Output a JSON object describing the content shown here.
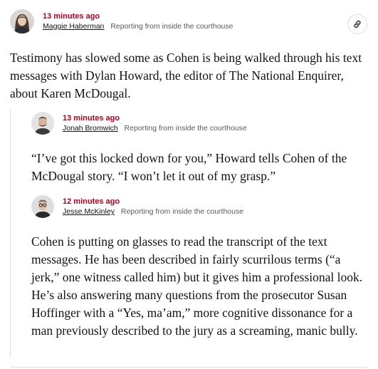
{
  "posts": [
    {
      "timestamp": "13 minutes ago",
      "author": "Maggie Haberman",
      "dateline": "Reporting from inside the courthouse",
      "text": "Testimony has slowed some as Cohen is being walked through his text messages with Dylan Howard, the editor of The National Enquirer, about Karen McDougal."
    },
    {
      "timestamp": "13 minutes ago",
      "author": "Jonah Bromwich",
      "dateline": "Reporting from inside the courthouse",
      "text": "“I’ve got this locked down for you,” Howard tells Cohen of the McDougal story. “I won’t let it out of my grasp.”"
    },
    {
      "timestamp": "12 minutes ago",
      "author": "Jesse McKinley",
      "dateline": "Reporting from inside the courthouse",
      "text": "Cohen is putting on glasses to read the transcript of the text messages. He has been described in fairly scurrilous terms (“a jerk,” one witness called him) but it gives him a professional look. He’s also answering many questions from the prosecutor Susan Hoffinger with a “Yes, ma’am,” more cognitive dissonance for a man previously described to the jury as a screaming, manic bully."
    }
  ],
  "colors": {
    "timestamp": "#b2001e",
    "text": "#121212",
    "dateline": "#5a5a5a",
    "rule": "#dcdcdc"
  },
  "icons": {
    "share": "link-icon"
  }
}
